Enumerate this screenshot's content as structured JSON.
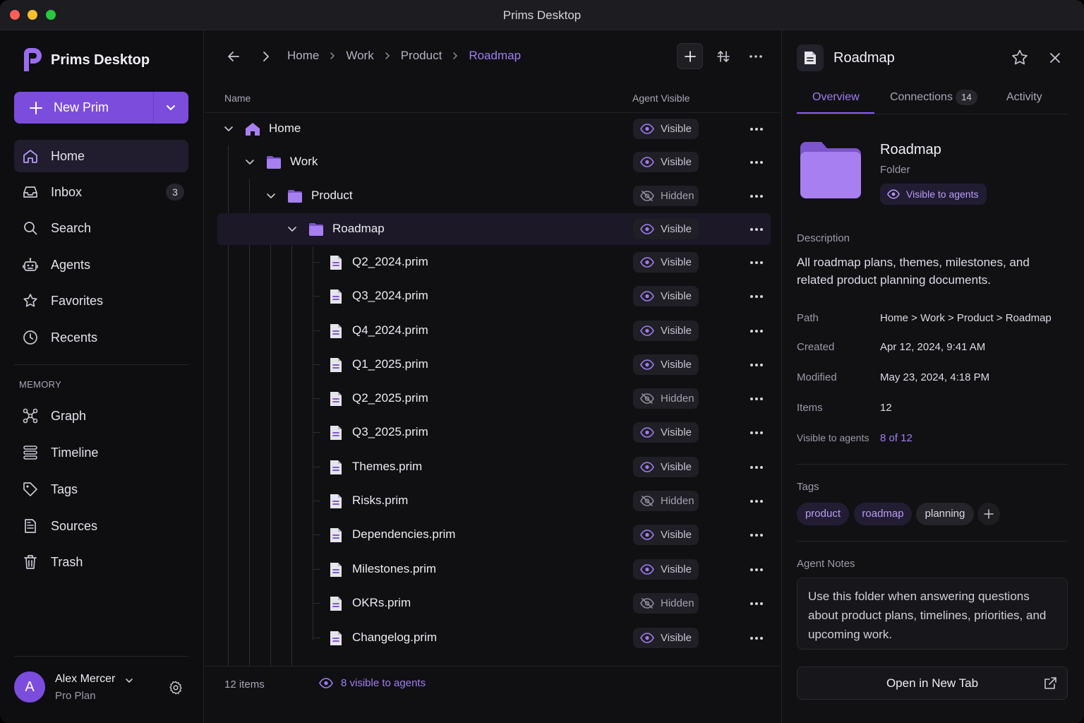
{
  "window": {
    "title": "Prims Desktop"
  },
  "sidebar": {
    "brand": "Prims Desktop",
    "new_button": "New Prim",
    "nav": [
      {
        "label": "Home",
        "icon": "home-icon",
        "active": true
      },
      {
        "label": "Inbox",
        "icon": "inbox-icon",
        "badge": "3"
      },
      {
        "label": "Search",
        "icon": "search-icon"
      },
      {
        "label": "Agents",
        "icon": "robot-icon"
      },
      {
        "label": "Favorites",
        "icon": "star-icon"
      },
      {
        "label": "Recents",
        "icon": "clock-icon"
      }
    ],
    "section_label": "MEMORY",
    "memory": [
      {
        "label": "Graph",
        "icon": "graph-icon"
      },
      {
        "label": "Timeline",
        "icon": "timeline-icon"
      },
      {
        "label": "Tags",
        "icon": "tag-icon"
      },
      {
        "label": "Sources",
        "icon": "document-icon"
      },
      {
        "label": "Trash",
        "icon": "trash-icon"
      }
    ],
    "user": {
      "initial": "A",
      "name": "Alex Mercer",
      "plan": "Pro Plan"
    }
  },
  "main": {
    "breadcrumbs": [
      "Home",
      "Work",
      "Product",
      "Roadmap"
    ],
    "columns": {
      "name": "Name",
      "agent_visible": "Agent Visible"
    },
    "rows": [
      {
        "name": "Home",
        "type": "home",
        "visibility": "Visible"
      },
      {
        "name": "Work",
        "type": "folder",
        "visibility": "Visible"
      },
      {
        "name": "Product",
        "type": "folder",
        "visibility": "Hidden"
      },
      {
        "name": "Roadmap",
        "type": "folder",
        "visibility": "Visible",
        "selected": true
      },
      {
        "name": "Q2_2024.prim",
        "type": "file",
        "visibility": "Visible"
      },
      {
        "name": "Q3_2024.prim",
        "type": "file",
        "visibility": "Visible"
      },
      {
        "name": "Q4_2024.prim",
        "type": "file",
        "visibility": "Visible"
      },
      {
        "name": "Q1_2025.prim",
        "type": "file",
        "visibility": "Visible"
      },
      {
        "name": "Q2_2025.prim",
        "type": "file",
        "visibility": "Hidden"
      },
      {
        "name": "Q3_2025.prim",
        "type": "file",
        "visibility": "Visible"
      },
      {
        "name": "Themes.prim",
        "type": "file",
        "visibility": "Visible"
      },
      {
        "name": "Risks.prim",
        "type": "file",
        "visibility": "Hidden"
      },
      {
        "name": "Dependencies.prim",
        "type": "file",
        "visibility": "Visible"
      },
      {
        "name": "Milestones.prim",
        "type": "file",
        "visibility": "Visible"
      },
      {
        "name": "OKRs.prim",
        "type": "file",
        "visibility": "Hidden"
      },
      {
        "name": "Changelog.prim",
        "type": "file",
        "visibility": "Visible"
      }
    ],
    "footer": {
      "count": "12 items",
      "visible": "8 visible to agents"
    }
  },
  "details": {
    "title": "Roadmap",
    "tabs": [
      {
        "label": "Overview",
        "active": true
      },
      {
        "label": "Connections",
        "badge": "14"
      },
      {
        "label": "Activity"
      }
    ],
    "name": "Roadmap",
    "kind": "Folder",
    "visibility_chip": "Visible to agents",
    "description_label": "Description",
    "description": "All roadmap plans, themes, milestones, and related product planning documents.",
    "properties": [
      {
        "key": "Path",
        "value": "Home > Work > Product > Roadmap"
      },
      {
        "key": "Created",
        "value": "Apr 12, 2024, 9:41 AM"
      },
      {
        "key": "Modified",
        "value": "May 23, 2024, 4:18 PM"
      },
      {
        "key": "Items",
        "value": "12"
      },
      {
        "key": "Visible to agents",
        "value": "8 of 12",
        "link": true
      }
    ],
    "tags_label": "Tags",
    "tags": [
      "product",
      "roadmap",
      "planning"
    ],
    "notes_label": "Agent Notes",
    "notes": "Use this folder when answering questions about product plans, timelines, priorities, and upcoming work.",
    "open_button": "Open in New Tab"
  },
  "colors": {
    "accent": "#7c4ddc",
    "accent_text": "#a07cf0",
    "background": "#0f0f12"
  }
}
